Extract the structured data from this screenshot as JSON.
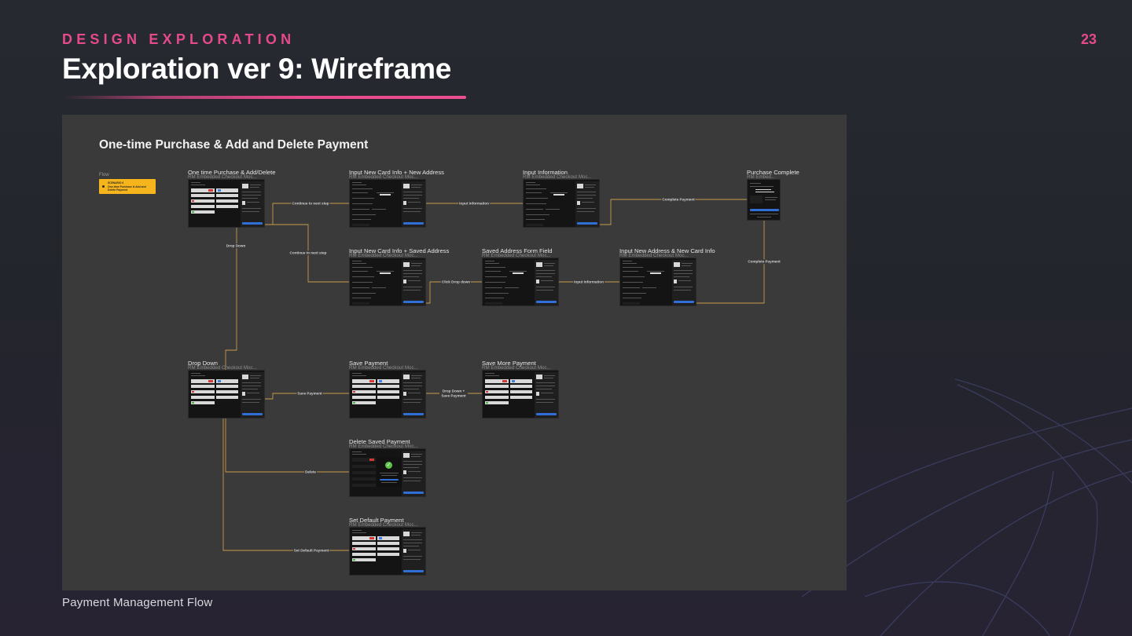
{
  "slide": {
    "kicker": "DESIGN EXPLORATION",
    "page_number": "23",
    "title": "Exploration ver 9: Wireframe",
    "footer": "Payment Management Flow",
    "accent_color": "#e64a8c"
  },
  "canvas": {
    "title": "One-time Purchase & Add and Delete Payment",
    "flow_label": "Flow",
    "flow_tag": {
      "kind": "SCENARIO 6",
      "name": "One-time Purchase & Add and Delete Payment",
      "color": "#f6b51c"
    },
    "wire_color": "#c99a4a"
  },
  "nodes": [
    {
      "id": "onetime",
      "title": "One time Purchase & Add/Delete",
      "subtitle": "RM Embedded Checkout Moc...",
      "variant": "list"
    },
    {
      "id": "newcard_newaddr",
      "title": "Input New Card Info + New Address",
      "subtitle": "RM Embedded Checkout Moc...",
      "variant": "form"
    },
    {
      "id": "input_info",
      "title": "Input Information",
      "subtitle": "RM Embedded Checkout Moc...",
      "variant": "form"
    },
    {
      "id": "complete",
      "title": "Purchase Complete",
      "subtitle": "RM Embed...",
      "variant": "complete"
    },
    {
      "id": "newcard_savedaddr",
      "title": "Input New Card Info + Saved Address",
      "subtitle": "RM Embedded Checkout Moc...",
      "variant": "form"
    },
    {
      "id": "saved_addr_field",
      "title": "Saved Address Form Field",
      "subtitle": "RM Embedded Checkout Moc...",
      "variant": "form"
    },
    {
      "id": "newaddr_newcard",
      "title": "Input New Address & New Card Info",
      "subtitle": "RM Embedded Checkout Moc...",
      "variant": "form"
    },
    {
      "id": "dropdown",
      "title": "Drop Down",
      "subtitle": "RM Embedded Checkout Moc...",
      "variant": "list"
    },
    {
      "id": "save_payment",
      "title": "Save Payment",
      "subtitle": "RM Embedded Checkout Moc...",
      "variant": "list"
    },
    {
      "id": "save_more",
      "title": "Save More Payment",
      "subtitle": "RM Embedded Checkout Moc...",
      "variant": "list"
    },
    {
      "id": "delete_saved",
      "title": "Delete Saved Payment",
      "subtitle": "RM Embedded Checkout Moc...",
      "variant": "modal"
    },
    {
      "id": "set_default",
      "title": "Set Default Payment",
      "subtitle": "RM Embedded Checkout Moc...",
      "variant": "list"
    }
  ],
  "connections": [
    {
      "from": "onetime",
      "to": "newcard_newaddr",
      "label": "Continue to next step"
    },
    {
      "from": "newcard_newaddr",
      "to": "input_info",
      "label": "Input Information"
    },
    {
      "from": "input_info",
      "to": "complete",
      "label": "Complete Payment"
    },
    {
      "from": "onetime",
      "to": "newcard_savedaddr",
      "label": "Continue to next step"
    },
    {
      "from": "onetime",
      "to": "dropdown",
      "label": "Drop Down"
    },
    {
      "from": "newcard_savedaddr",
      "to": "saved_addr_field",
      "label": "Click Drop down"
    },
    {
      "from": "saved_addr_field",
      "to": "newaddr_newcard",
      "label": "Input Information"
    },
    {
      "from": "newaddr_newcard",
      "to": "complete",
      "label": "Complete Payment"
    },
    {
      "from": "dropdown",
      "to": "save_payment",
      "label": "Save Payment"
    },
    {
      "from": "save_payment",
      "to": "save_more",
      "label": "Drop Down + Save Payment"
    },
    {
      "from": "dropdown",
      "to": "delete_saved",
      "label": "Delete"
    },
    {
      "from": "dropdown",
      "to": "set_default",
      "label": "Set Default Payment"
    }
  ]
}
